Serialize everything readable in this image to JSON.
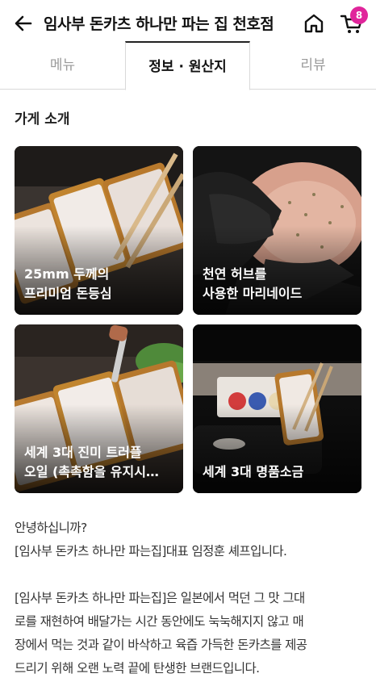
{
  "header": {
    "title": "임사부 돈카츠 하나만 파는 집 천호점",
    "cart_count": "8",
    "icons": {
      "back": "arrow-left-icon",
      "home": "home-icon",
      "cart": "cart-icon"
    },
    "accent_color": "#e0259b"
  },
  "tabs": [
    {
      "label": "메뉴",
      "active": false
    },
    {
      "label": "정보 · 원산지",
      "active": true
    },
    {
      "label": "리뷰",
      "active": false
    }
  ],
  "section": {
    "title": "가게 소개"
  },
  "cards": [
    {
      "line1": "25mm 두께의",
      "line2": "프리미엄 돈등심"
    },
    {
      "line1": "천연 허브를",
      "line2": "사용한 마리네이드"
    },
    {
      "line1": "세계 3대 진미 트러플",
      "line2": "오일 (촉촉함을 유지시…"
    },
    {
      "line1": "세계 3대 명품소금",
      "line2": ""
    }
  ],
  "intro": {
    "line1": "안녕하십니까?",
    "line2": "[임사부 돈카츠 하나만 파는집]대표 임정훈 셰프입니다.",
    "line3": "[임사부 돈카츠 하나만 파는집]은 일본에서 먹던 그 맛 그대",
    "line4": "로를 재현하여 배달가는 시간 동안에도 눅눅해지지 않고 매",
    "line5": "장에서 먹는 것과 같이 바삭하고 육즙 가득한 돈카츠를 제공",
    "line6": "드리기 위해 오랜 노력 끝에 탄생한 브랜드입니다."
  }
}
